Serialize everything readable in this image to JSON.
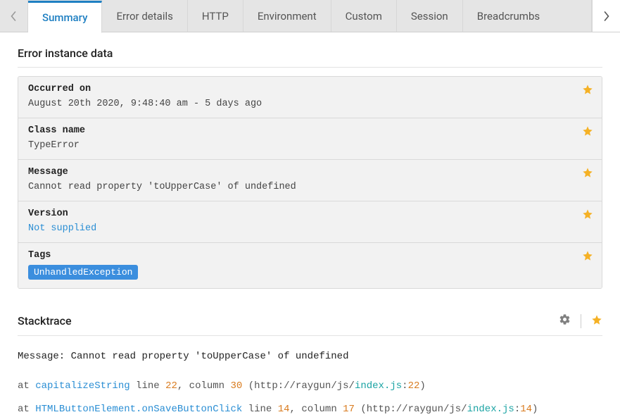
{
  "tabs": {
    "scroll_left": "‹",
    "scroll_right": "›",
    "items": [
      "Summary",
      "Error details",
      "HTTP",
      "Environment",
      "Custom",
      "Session",
      "Breadcrumbs"
    ],
    "active_index": 0
  },
  "section1_title": "Error instance data",
  "cards": [
    {
      "label": "Occurred on",
      "value": "August 20th 2020, 9:48:40 am - 5 days ago",
      "link": false,
      "tag": false
    },
    {
      "label": "Class name",
      "value": "TypeError",
      "link": false,
      "tag": false
    },
    {
      "label": "Message",
      "value": "Cannot read property 'toUpperCase' of undefined",
      "link": false,
      "tag": false
    },
    {
      "label": "Version",
      "value": "Not supplied",
      "link": true,
      "tag": false
    },
    {
      "label": "Tags",
      "value": "UnhandledException",
      "link": false,
      "tag": true
    }
  ],
  "stacktrace": {
    "title": "Stacktrace",
    "message_label": "Message:",
    "message": "Cannot read property 'toUpperCase' of undefined",
    "frames": [
      {
        "at": "at ",
        "fn_pre": "",
        "fn_blue": "capitalizeString",
        "mid1": " line ",
        "line": "22",
        "mid2": ", column ",
        "col": "30",
        "mid3": " (http://raygun/js/",
        "file": "index.js",
        "sep": ":",
        "file_line": "22",
        "close": ")"
      },
      {
        "at": "at ",
        "fn_pre": "HTMLButtonElement.",
        "fn_blue": "onSaveButtonClick",
        "mid1": " line ",
        "line": "14",
        "mid2": ", column ",
        "col": "17",
        "mid3": " (http://raygun/js/",
        "file": "index.js",
        "sep": ":",
        "file_line": "14",
        "close": ")"
      }
    ]
  },
  "colors": {
    "star": "#f5b125",
    "gear": "#888"
  }
}
